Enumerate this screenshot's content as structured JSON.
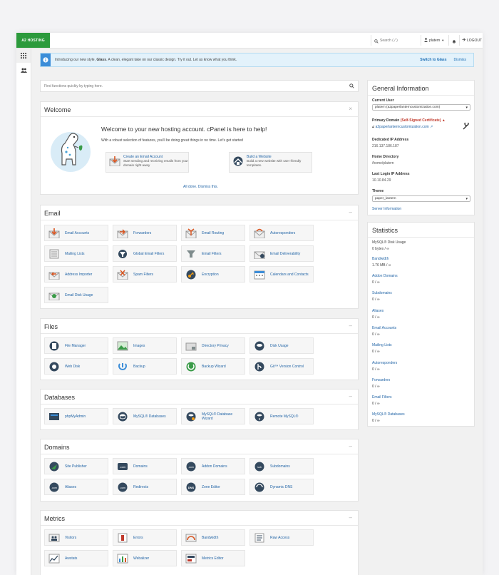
{
  "topbar": {
    "logo_text": "A2 HOSTING",
    "search_placeholder": "Search ( / )",
    "user_label": "platern",
    "logout_label": "LOGOUT"
  },
  "notice": {
    "text_before": "Introducing our new style, ",
    "text_bold": "Glass",
    "text_after": ". A clean, elegant take on our classic design. Try it out. Let us know what you think.",
    "switch_label": "Switch to Glass",
    "dismiss_label": "Dismiss"
  },
  "find": {
    "placeholder": "Find functions quickly by typing here."
  },
  "welcome": {
    "title": "Welcome",
    "heading": "Welcome to your new hosting account. cPanel is here to help!",
    "sub": "With a robust selection of features, you'll be doing great things in no time. Let's get started",
    "tiles": [
      {
        "title": "Create an Email Account",
        "desc": "Start sending and receiving emails from your domain right away"
      },
      {
        "title": "Build a Website",
        "desc": "Build a new website with user friendly templates."
      }
    ],
    "all_done": "All done. Dismiss this."
  },
  "sections": {
    "email": {
      "title": "Email",
      "items": [
        "Email Accounts",
        "Forwarders",
        "Email Routing",
        "Autoresponders",
        "Mailing Lists",
        "Global Email Filters",
        "Email Filters",
        "Email Deliverability",
        "Address Importer",
        "Spam Filters",
        "Encryption",
        "Calendars and Contacts",
        "Email Disk Usage"
      ]
    },
    "files": {
      "title": "Files",
      "items": [
        "File Manager",
        "Images",
        "Directory Privacy",
        "Disk Usage",
        "Web Disk",
        "Backup",
        "Backup Wizard",
        "Git™ Version Control"
      ]
    },
    "databases": {
      "title": "Databases",
      "items": [
        "phpMyAdmin",
        "MySQL® Databases",
        "MySQL® Database Wizard",
        "Remote MySQL®"
      ]
    },
    "domains": {
      "title": "Domains",
      "items": [
        "Site Publisher",
        "Domains",
        "Addon Domains",
        "Subdomains",
        "Aliases",
        "Redirects",
        "Zone Editor",
        "Dynamic DNS"
      ]
    },
    "metrics": {
      "title": "Metrics",
      "items": [
        "Visitors",
        "Errors",
        "Bandwidth",
        "Raw Access",
        "Awstats",
        "Webalizer",
        "Metrics Editor"
      ]
    }
  },
  "general": {
    "title": "General Information",
    "current_user_label": "Current User",
    "current_user_value": "platern (a2paperlanterncustomization.com)",
    "primary_domain_label": "Primary Domain",
    "primary_domain_warning": "(Self-Signed Certificate)",
    "primary_domain_value": "a2paperlanterncustomization.com",
    "dedicated_ip_label": "Dedicated IP Address",
    "dedicated_ip_value": "216.137.186.187",
    "home_dir_label": "Home Directory",
    "home_dir_value": "/home/platern",
    "last_login_label": "Last Login IP Address",
    "last_login_value": "10.10.84.29",
    "theme_label": "Theme",
    "theme_value": "paper_lantern",
    "server_info": "Server Information"
  },
  "statistics": {
    "title": "Statistics",
    "items": [
      {
        "label": "MySQL® Disk Usage",
        "value": "0 bytes / ∞"
      },
      {
        "label": "Bandwidth",
        "value": "1.76 MB / ∞"
      },
      {
        "label": "Addon Domains",
        "value": "0 / ∞"
      },
      {
        "label": "Subdomains",
        "value": "0 / ∞"
      },
      {
        "label": "Aliases",
        "value": "0 / ∞"
      },
      {
        "label": "Email Accounts",
        "value": "0 / ∞"
      },
      {
        "label": "Mailing Lists",
        "value": "0 / ∞"
      },
      {
        "label": "Autoresponders",
        "value": "0 / ∞"
      },
      {
        "label": "Forwarders",
        "value": "0 / ∞"
      },
      {
        "label": "Email Filters",
        "value": "0 / ∞"
      },
      {
        "label": "MySQL® Databases",
        "value": "0 / ∞"
      }
    ]
  },
  "colors": {
    "brand": "#2c9a3c",
    "link": "#2466a7",
    "notice_bg": "#e3f2fb",
    "warning": "#c0392b"
  }
}
